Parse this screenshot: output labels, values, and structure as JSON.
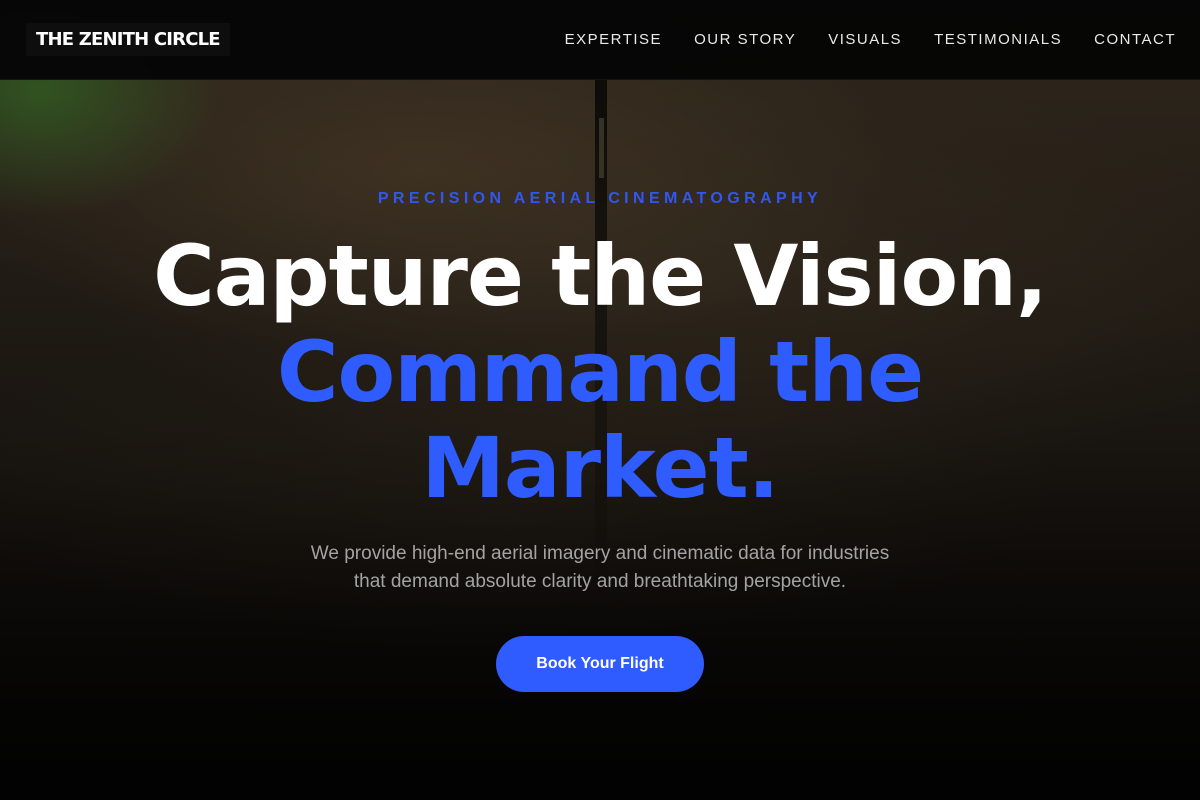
{
  "header": {
    "logo": "THE ZENITH CIRCLE",
    "nav": [
      {
        "label": "EXPERTISE"
      },
      {
        "label": "OUR STORY"
      },
      {
        "label": "VISUALS"
      },
      {
        "label": "TESTIMONIALS"
      },
      {
        "label": "CONTACT"
      }
    ]
  },
  "hero": {
    "eyebrow": "PRECISION AERIAL CINEMATOGRAPHY",
    "headline_line1": "Capture the Vision,",
    "headline_line2": "Command the",
    "headline_line3": "Market.",
    "description_line1": "We provide high-end aerial imagery and cinematic data for industries",
    "description_line2": "that demand absolute clarity and breathtaking perspective.",
    "cta_label": "Book Your Flight"
  },
  "colors": {
    "accent": "#2f5cff",
    "header_bg": "#050505",
    "text_primary": "#ffffff",
    "text_muted": "#a3a3a3"
  }
}
